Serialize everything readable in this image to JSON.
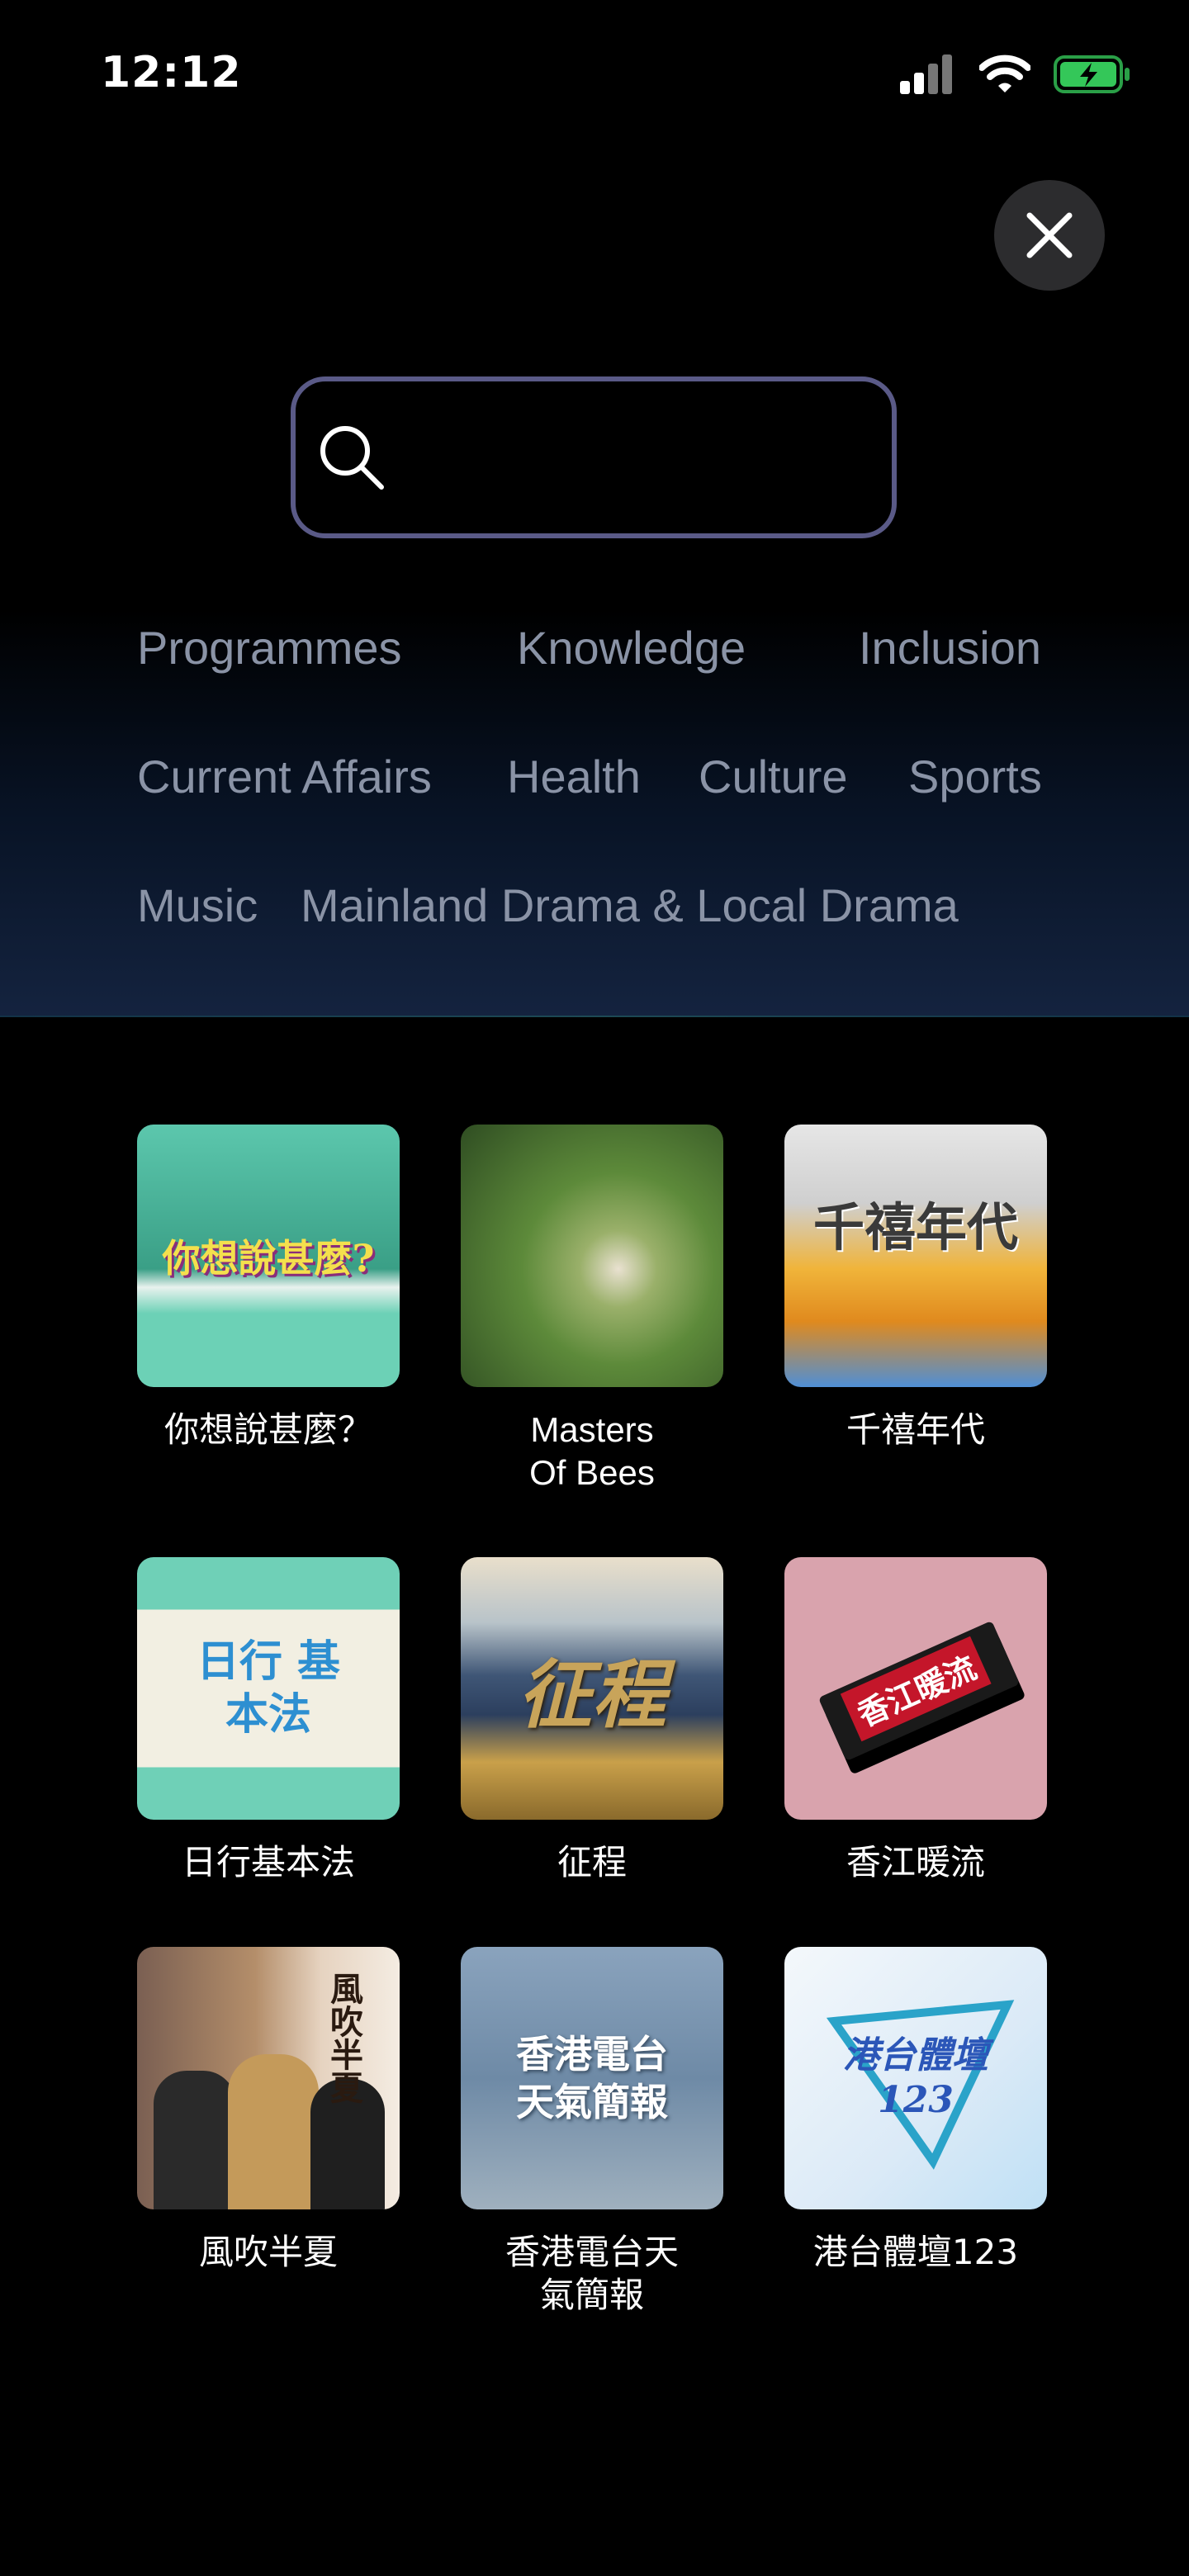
{
  "status_bar": {
    "time": "12:12"
  },
  "icons": {
    "signal": "cellular-signal-icon",
    "wifi": "wifi-icon",
    "battery": "battery-charging-icon",
    "close": "close-icon",
    "search": "search-icon"
  },
  "search": {
    "value": "",
    "placeholder": ""
  },
  "categories": [
    "Programmes",
    "Knowledge",
    "Inclusion",
    "Current Affairs",
    "Health",
    "Culture",
    "Sports",
    "Music",
    "Mainland Drama & Local Drama"
  ],
  "programmes": [
    {
      "title": "你想說甚麼？",
      "art_text": "你想說甚麼?"
    },
    {
      "title": "Masters\nOf Bees",
      "art_text": ""
    },
    {
      "title": "千禧年代",
      "art_text": "千禧年代"
    },
    {
      "title": "日行基本法",
      "art_text": "日行 基本法"
    },
    {
      "title": "征程",
      "art_text": "征程"
    },
    {
      "title": "香江暖流",
      "art_text": "香江暖流"
    },
    {
      "title": "風吹半夏",
      "art_text": "風吹半夏"
    },
    {
      "title": "香港電台天\n氣簡報",
      "art_text": "香港電台 天氣簡報"
    },
    {
      "title": "港台體壇123",
      "art_text": "港台體壇 123"
    }
  ],
  "colors": {
    "accent_border": "#5a5a87",
    "category_text": "#8a93a6",
    "battery_green": "#34c759"
  }
}
